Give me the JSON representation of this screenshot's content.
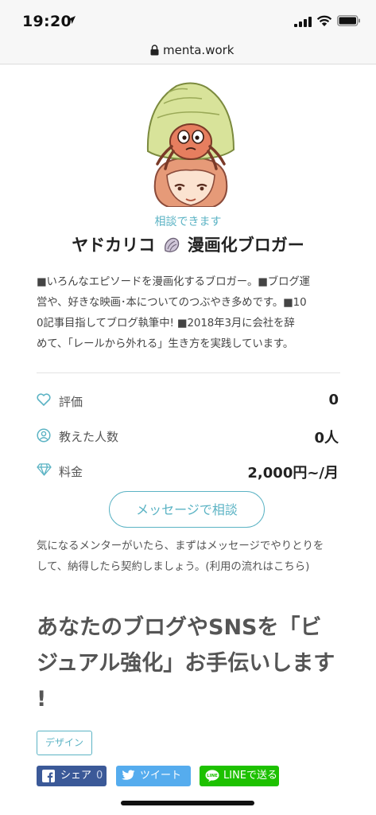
{
  "status_bar": {
    "time": "19:20"
  },
  "browser": {
    "url": "menta.work"
  },
  "profile": {
    "status": "相談できます",
    "name_part1": "ヤドカリコ",
    "name_part2": "漫画化ブロガー",
    "bio_lines": [
      "■いろんなエピソードを漫画化するブロガー。■ブログ運",
      "営や、好きな映画･本についてのつぶやき多めです。■10",
      "0記事目指してブログ執筆中! ■2018年3月に会社を辞",
      "めて、「レールから外れる」生き方を実践しています。"
    ]
  },
  "stats": {
    "rating_label": "評価",
    "rating_value": "0",
    "students_label": "教えた人数",
    "students_value": "0人",
    "fee_label": "料金",
    "fee_value": "2,000円~/月"
  },
  "message_button": "メッセージで相談",
  "note": {
    "line1": "気になるメンターがいたら、まずはメッセージでやりとりを",
    "line2_text": "して、納得したら契約しましょう。(利用の流れは",
    "line2_link": "こちら",
    "line2_end": ")"
  },
  "headline_lines": [
    "あなたのブログやSNSを「ビ",
    "ジュアル強化」お手伝いします",
    "!"
  ],
  "tag": "デザイン",
  "share": {
    "facebook_label": "シェア",
    "facebook_count": "0",
    "twitter_label": "ツイート",
    "line_label": "LINEで送る"
  },
  "colors": {
    "accent": "#5bb3c4",
    "facebook": "#3b5998",
    "twitter": "#55acee",
    "line": "#1dc100"
  }
}
